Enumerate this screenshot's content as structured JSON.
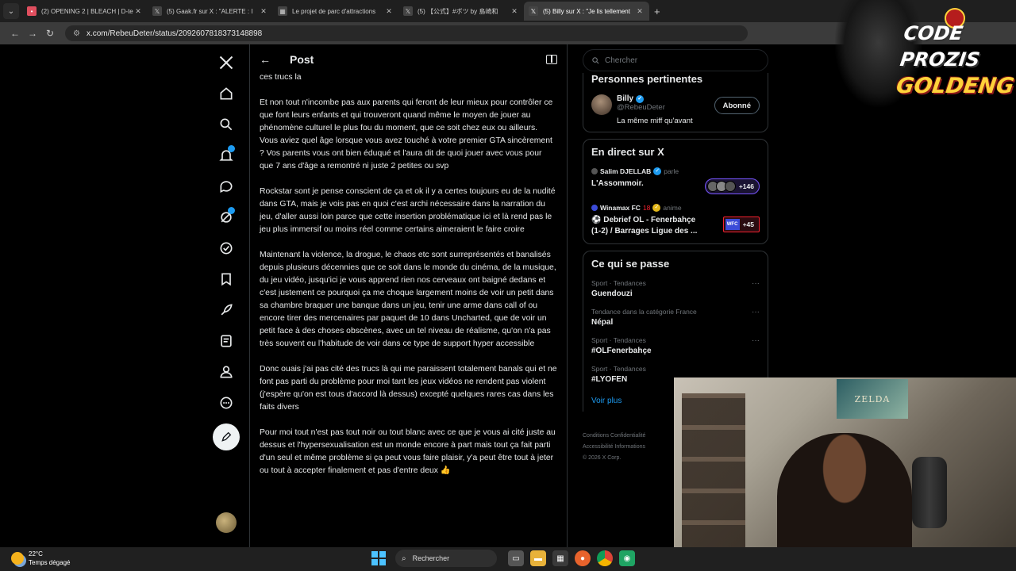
{
  "browser": {
    "tabs": [
      {
        "title": "(2) OPENING 2 | BLEACH | D-te",
        "active": false,
        "audio": true
      },
      {
        "title": "(5) Gaak.fr sur X : \"ALERTE : I",
        "active": false
      },
      {
        "title": "Le projet de parc d'attractions",
        "active": false
      },
      {
        "title": "(5) 【公式】#ボツ by 島崎和",
        "active": false
      },
      {
        "title": "(5) Billy sur X : \"Je lis tellement",
        "active": true
      }
    ],
    "url": "x.com/RebeuDeter/status/2092607818373148898"
  },
  "post": {
    "header_title": "Post",
    "paragraphs": [
      "ces trucs la",
      "Et non tout n'incombe pas aux parents qui feront de leur mieux pour contrôler ce que font leurs enfants et qui trouveront quand même le moyen de jouer au phénomène culturel le plus fou du moment, que ce soit chez eux ou ailleurs. Vous aviez quel âge lorsque vous avez touché à votre premier GTA sincèrement ? Vos parents vous ont bien éduqué et l'aura dit de quoi jouer avec vous pour que 7 ans d'âge a remontré ni juste 2 petites ou svp",
      "Rockstar sont je pense conscient de ça et ok il y a certes toujours eu de la nudité dans GTA, mais je vois pas en quoi c'est archi nécessaire dans la narration du jeu, d'aller aussi loin parce que cette insertion problématique ici et là rend pas le jeu plus immersif ou moins réel comme certains aimeraient le faire croire",
      "Maintenant la violence, la drogue, le chaos etc sont surreprésentés et banalisés depuis plusieurs décennies que ce soit dans le monde du cinéma, de la musique, du jeu vidéo, jusqu'ici je vous apprend rien nos cerveaux ont baigné dedans et c'est justement ce pourquoi ça me choque largement moins de voir un petit dans sa chambre braquer une banque dans un jeu, tenir une arme dans call of ou encore tirer des mercenaires par paquet de 10 dans Uncharted, que de voir un petit face à des choses obscènes, avec un tel niveau de réalisme, qu'on n'a pas très souvent eu l'habitude de voir dans ce type de support hyper accessible",
      "Donc ouais j'ai pas cité des trucs là qui me paraissent totalement banals qui et ne font pas parti du problème pour moi tant les jeux vidéos ne rendent pas violent (j'espère qu'on est tous d'accord là dessus) excepté quelques rares cas dans les faits divers",
      "Pour moi tout n'est pas tout noir ou tout blanc avec ce que je vous ai cité juste au dessus et l'hypersexualisation est un monde encore à part mais tout ça fait parti d'un seul et même problème si ça peut vous faire plaisir, y'a peut être tout à jeter ou tout à accepter finalement et pas d'entre deux 👍"
    ]
  },
  "sidebar": {
    "search_placeholder": "Chercher",
    "relevant": {
      "title": "Personnes pertinentes",
      "name": "Billy",
      "handle": "@RebeuDeter",
      "bio": "La même miff qu'avant",
      "follow_label": "Abonné"
    },
    "live": {
      "title": "En direct sur X",
      "items": [
        {
          "host": "Salim DJELLAB",
          "status": "parle",
          "title": "L'Assommoir.",
          "viewers": "+146"
        },
        {
          "host": "Winamax FC",
          "extra": "18",
          "status": "anime",
          "title": "⚽ Debrief OL - Fenerbahçe (1-2) / Barrages Ligue des ...",
          "viewers": "+45",
          "badge": "WFC"
        }
      ]
    },
    "trends": {
      "title": "Ce qui se passe",
      "items": [
        {
          "category": "Sport · Tendances",
          "name": "Guendouzi"
        },
        {
          "category": "Tendance dans la catégorie France",
          "name": "Népal"
        },
        {
          "category": "Sport · Tendances",
          "name": "#OLFenerbahçe"
        },
        {
          "category": "Sport · Tendances",
          "name": "#LYOFEN"
        }
      ],
      "more": "···",
      "see_more": "Voir plus"
    },
    "footer": {
      "l1": "Conditions   Confidentialité",
      "l2": "Accessibilité   Informations",
      "l3": "© 2026 X Corp."
    }
  },
  "overlay": {
    "logo_line1": "CODE PROZIS",
    "logo_line2": "GOLDENG",
    "poster_text": "ZELDA"
  },
  "taskbar": {
    "temp": "22°C",
    "weather": "Temps dégagé",
    "search": "Rechercher"
  }
}
